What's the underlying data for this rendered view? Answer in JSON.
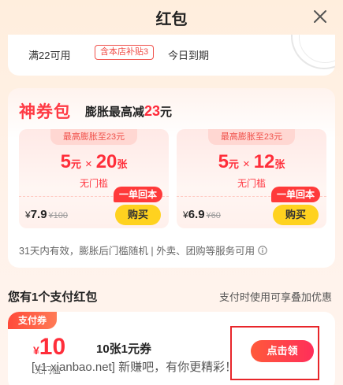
{
  "header": {
    "title": "红包"
  },
  "top_card": {
    "min_spend": "满22可用",
    "subsidy_tag": "含本店补贴3",
    "expiry": "今日到期"
  },
  "shenquan": {
    "title": "神券包",
    "subtitle_prefix": "膨胀最高减",
    "subtitle_amount": "23",
    "subtitle_unit": "元",
    "coupons": [
      {
        "cap_label": "最高膨胀至23元",
        "value": "5",
        "value_unit": "元",
        "times": "×",
        "count": "20",
        "count_unit": "张",
        "threshold": "无门槛",
        "promo": "一单回本",
        "price_symbol": "¥",
        "price": "7.9",
        "original_price": "¥100",
        "buy_label": "购买"
      },
      {
        "cap_label": "最高膨胀至23元",
        "value": "5",
        "value_unit": "元",
        "times": "×",
        "count": "12",
        "count_unit": "张",
        "threshold": "无门槛",
        "promo": "一单回本",
        "price_symbol": "¥",
        "price": "6.9",
        "original_price": "¥60",
        "buy_label": "购买"
      }
    ],
    "note": "31天内有效，膨胀后门槛随机 | 外卖、团购等服务可用"
  },
  "pay_section": {
    "title": "您有1个支付红包",
    "hint": "支付时使用可享叠加优惠",
    "coupon": {
      "badge": "支付券",
      "currency": "¥",
      "amount": "10",
      "name": "10张1元券",
      "threshold": "无门槛",
      "claim_label": "点击领"
    }
  },
  "watermark": "[v1.xianbao.net] 新赚吧，有你更精彩！",
  "colors": {
    "accent": "#ff2e3a",
    "buy": "#ffd21f",
    "highlight": "#e8262a"
  },
  "icons": {
    "close": "close-icon",
    "info": "info-icon"
  }
}
